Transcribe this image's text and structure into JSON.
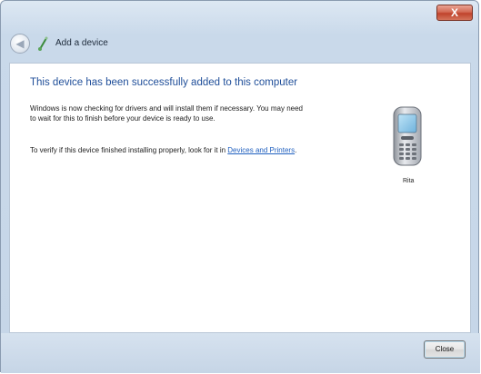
{
  "window": {
    "title": "Add a device",
    "close_glyph": "X"
  },
  "main": {
    "heading": "This device has been successfully added to this computer",
    "paragraph1": "Windows is now checking for drivers and will install them if necessary. You may need to wait for this to finish before your device is ready to use.",
    "paragraph2_text": "To verify if this device finished installing properly, look for it in ",
    "paragraph2_link": "Devices and Printers",
    "paragraph2_end": "."
  },
  "device": {
    "icon": "mobile-phone-icon",
    "name": "Rita"
  },
  "footer": {
    "close_label": "Close"
  },
  "colors": {
    "heading": "#1f4e99",
    "link": "#1f5fbf",
    "titlebar_close": "#c0432c"
  }
}
